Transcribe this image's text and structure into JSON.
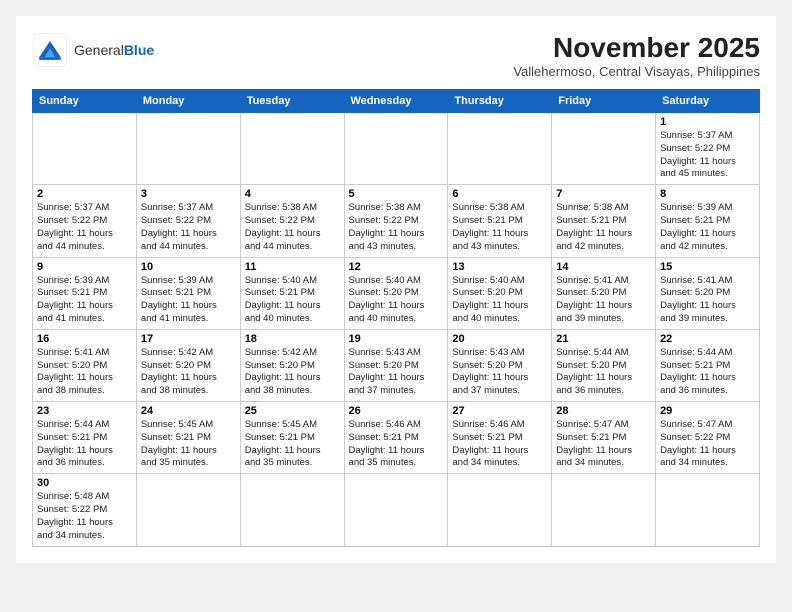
{
  "header": {
    "logo_general": "General",
    "logo_blue": "Blue",
    "month_title": "November 2025",
    "location": "Vallehermoso, Central Visayas, Philippines"
  },
  "weekdays": [
    "Sunday",
    "Monday",
    "Tuesday",
    "Wednesday",
    "Thursday",
    "Friday",
    "Saturday"
  ],
  "weeks": [
    [
      {
        "day": "",
        "info": ""
      },
      {
        "day": "",
        "info": ""
      },
      {
        "day": "",
        "info": ""
      },
      {
        "day": "",
        "info": ""
      },
      {
        "day": "",
        "info": ""
      },
      {
        "day": "",
        "info": ""
      },
      {
        "day": "1",
        "info": "Sunrise: 5:37 AM\nSunset: 5:22 PM\nDaylight: 11 hours\nand 45 minutes."
      }
    ],
    [
      {
        "day": "2",
        "info": "Sunrise: 5:37 AM\nSunset: 5:22 PM\nDaylight: 11 hours\nand 44 minutes."
      },
      {
        "day": "3",
        "info": "Sunrise: 5:37 AM\nSunset: 5:22 PM\nDaylight: 11 hours\nand 44 minutes."
      },
      {
        "day": "4",
        "info": "Sunrise: 5:38 AM\nSunset: 5:22 PM\nDaylight: 11 hours\nand 44 minutes."
      },
      {
        "day": "5",
        "info": "Sunrise: 5:38 AM\nSunset: 5:22 PM\nDaylight: 11 hours\nand 43 minutes."
      },
      {
        "day": "6",
        "info": "Sunrise: 5:38 AM\nSunset: 5:21 PM\nDaylight: 11 hours\nand 43 minutes."
      },
      {
        "day": "7",
        "info": "Sunrise: 5:38 AM\nSunset: 5:21 PM\nDaylight: 11 hours\nand 42 minutes."
      },
      {
        "day": "8",
        "info": "Sunrise: 5:39 AM\nSunset: 5:21 PM\nDaylight: 11 hours\nand 42 minutes."
      }
    ],
    [
      {
        "day": "9",
        "info": "Sunrise: 5:39 AM\nSunset: 5:21 PM\nDaylight: 11 hours\nand 41 minutes."
      },
      {
        "day": "10",
        "info": "Sunrise: 5:39 AM\nSunset: 5:21 PM\nDaylight: 11 hours\nand 41 minutes."
      },
      {
        "day": "11",
        "info": "Sunrise: 5:40 AM\nSunset: 5:21 PM\nDaylight: 11 hours\nand 40 minutes."
      },
      {
        "day": "12",
        "info": "Sunrise: 5:40 AM\nSunset: 5:20 PM\nDaylight: 11 hours\nand 40 minutes."
      },
      {
        "day": "13",
        "info": "Sunrise: 5:40 AM\nSunset: 5:20 PM\nDaylight: 11 hours\nand 40 minutes."
      },
      {
        "day": "14",
        "info": "Sunrise: 5:41 AM\nSunset: 5:20 PM\nDaylight: 11 hours\nand 39 minutes."
      },
      {
        "day": "15",
        "info": "Sunrise: 5:41 AM\nSunset: 5:20 PM\nDaylight: 11 hours\nand 39 minutes."
      }
    ],
    [
      {
        "day": "16",
        "info": "Sunrise: 5:41 AM\nSunset: 5:20 PM\nDaylight: 11 hours\nand 38 minutes."
      },
      {
        "day": "17",
        "info": "Sunrise: 5:42 AM\nSunset: 5:20 PM\nDaylight: 11 hours\nand 38 minutes."
      },
      {
        "day": "18",
        "info": "Sunrise: 5:42 AM\nSunset: 5:20 PM\nDaylight: 11 hours\nand 38 minutes."
      },
      {
        "day": "19",
        "info": "Sunrise: 5:43 AM\nSunset: 5:20 PM\nDaylight: 11 hours\nand 37 minutes."
      },
      {
        "day": "20",
        "info": "Sunrise: 5:43 AM\nSunset: 5:20 PM\nDaylight: 11 hours\nand 37 minutes."
      },
      {
        "day": "21",
        "info": "Sunrise: 5:44 AM\nSunset: 5:20 PM\nDaylight: 11 hours\nand 36 minutes."
      },
      {
        "day": "22",
        "info": "Sunrise: 5:44 AM\nSunset: 5:21 PM\nDaylight: 11 hours\nand 36 minutes."
      }
    ],
    [
      {
        "day": "23",
        "info": "Sunrise: 5:44 AM\nSunset: 5:21 PM\nDaylight: 11 hours\nand 36 minutes."
      },
      {
        "day": "24",
        "info": "Sunrise: 5:45 AM\nSunset: 5:21 PM\nDaylight: 11 hours\nand 35 minutes."
      },
      {
        "day": "25",
        "info": "Sunrise: 5:45 AM\nSunset: 5:21 PM\nDaylight: 11 hours\nand 35 minutes."
      },
      {
        "day": "26",
        "info": "Sunrise: 5:46 AM\nSunset: 5:21 PM\nDaylight: 11 hours\nand 35 minutes."
      },
      {
        "day": "27",
        "info": "Sunrise: 5:46 AM\nSunset: 5:21 PM\nDaylight: 11 hours\nand 34 minutes."
      },
      {
        "day": "28",
        "info": "Sunrise: 5:47 AM\nSunset: 5:21 PM\nDaylight: 11 hours\nand 34 minutes."
      },
      {
        "day": "29",
        "info": "Sunrise: 5:47 AM\nSunset: 5:22 PM\nDaylight: 11 hours\nand 34 minutes."
      }
    ],
    [
      {
        "day": "30",
        "info": "Sunrise: 5:48 AM\nSunset: 5:22 PM\nDaylight: 11 hours\nand 34 minutes."
      },
      {
        "day": "",
        "info": ""
      },
      {
        "day": "",
        "info": ""
      },
      {
        "day": "",
        "info": ""
      },
      {
        "day": "",
        "info": ""
      },
      {
        "day": "",
        "info": ""
      },
      {
        "day": "",
        "info": ""
      }
    ]
  ]
}
